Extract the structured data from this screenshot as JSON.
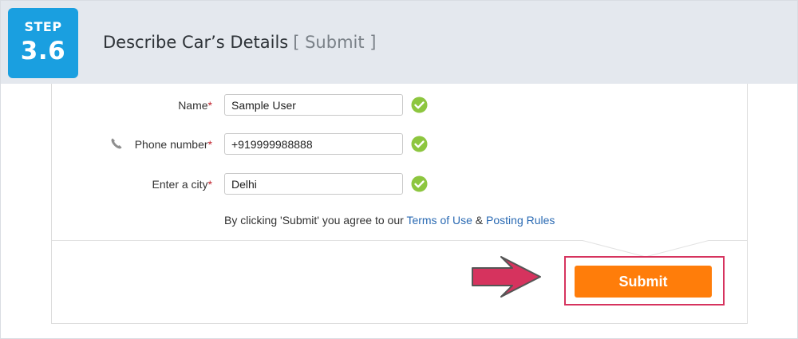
{
  "header": {
    "step_word": "STEP",
    "step_number": "3.6",
    "title": "Describe Car’s Details",
    "subtitle": "[ Submit ]"
  },
  "form": {
    "name": {
      "label": "Name",
      "required_mark": "*",
      "value": "Sample User"
    },
    "phone": {
      "label": "Phone number",
      "required_mark": "*",
      "value": "+919999988888"
    },
    "city": {
      "label": "Enter a city",
      "required_mark": "*",
      "value": "Delhi"
    }
  },
  "agreement": {
    "prefix": "By clicking 'Submit' you agree to our",
    "terms_link": "Terms of Use",
    "ampersand": "&",
    "rules_link": "Posting Rules"
  },
  "actions": {
    "submit_label": "Submit"
  },
  "colors": {
    "step_badge": "#1a9fe0",
    "header_bg": "#e4e8ee",
    "valid_check": "#8dc63f",
    "submit": "#ff7d0a",
    "highlight": "#d6335e",
    "link": "#2a6ab3"
  },
  "icons": {
    "phone": "phone-icon",
    "valid": "check-circle-icon",
    "pointer": "arrow-right-icon"
  }
}
